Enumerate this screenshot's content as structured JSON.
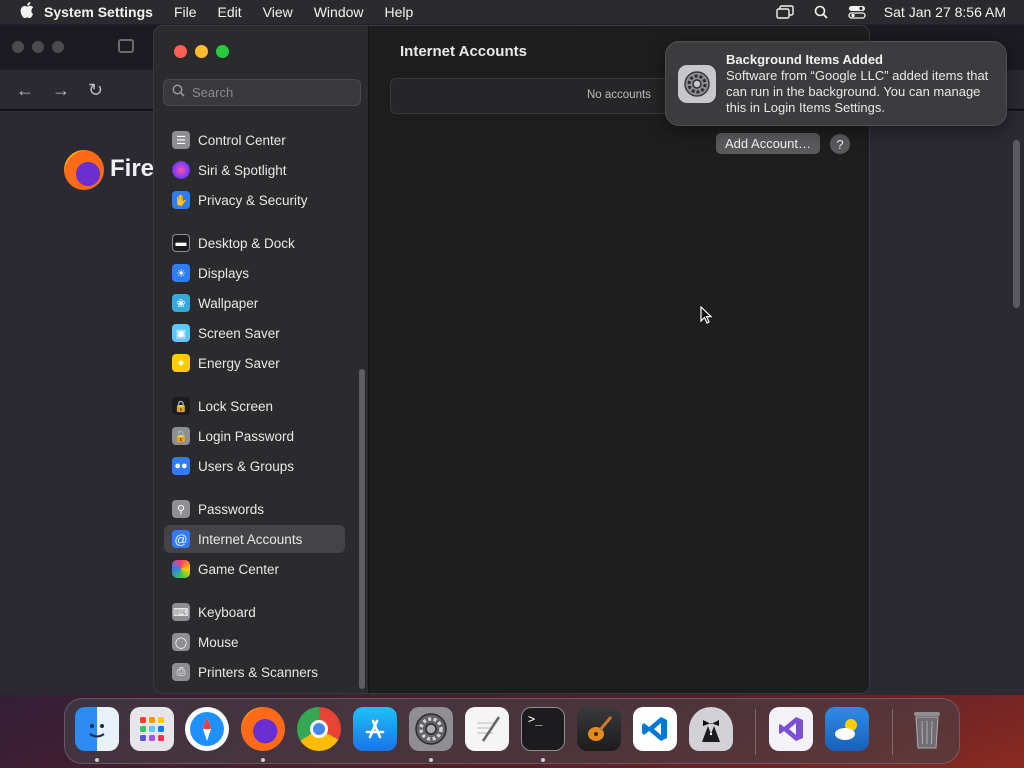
{
  "menubar": {
    "app_name": "System Settings",
    "menus": [
      "File",
      "Edit",
      "View",
      "Window",
      "Help"
    ],
    "clock": "Sat Jan 27  8:56 AM"
  },
  "firefox": {
    "brand_text": "Fire"
  },
  "settings": {
    "search_placeholder": "Search",
    "sidebar_items": [
      {
        "label": "Control Center",
        "icon": "control-center-icon",
        "color": "#8e8e93"
      },
      {
        "label": "Siri & Spotlight",
        "icon": "siri-icon",
        "color": "#b03ad1"
      },
      {
        "label": "Privacy & Security",
        "icon": "hand-icon",
        "color": "#2f7cf6"
      },
      {
        "label": "Desktop & Dock",
        "icon": "dock-icon",
        "color": "#1c1c1e"
      },
      {
        "label": "Displays",
        "icon": "sun-icon",
        "color": "#2f7cf6"
      },
      {
        "label": "Wallpaper",
        "icon": "wallpaper-icon",
        "color": "#34aadc"
      },
      {
        "label": "Screen Saver",
        "icon": "screen-saver-icon",
        "color": "#5ac8fa"
      },
      {
        "label": "Energy Saver",
        "icon": "bulb-icon",
        "color": "#ffcc00"
      },
      {
        "label": "Lock Screen",
        "icon": "lock-icon",
        "color": "#1c1c1e"
      },
      {
        "label": "Login Password",
        "icon": "lock-icon",
        "color": "#8e8e93"
      },
      {
        "label": "Users & Groups",
        "icon": "users-icon",
        "color": "#2f7cf6"
      },
      {
        "label": "Passwords",
        "icon": "key-icon",
        "color": "#8e8e93"
      },
      {
        "label": "Internet Accounts",
        "icon": "at-icon",
        "color": "#2f7cf6"
      },
      {
        "label": "Game Center",
        "icon": "game-center-icon",
        "color": "#ffffff"
      },
      {
        "label": "Keyboard",
        "icon": "keyboard-icon",
        "color": "#8e8e93"
      },
      {
        "label": "Mouse",
        "icon": "mouse-icon",
        "color": "#8e8e93"
      },
      {
        "label": "Printers & Scanners",
        "icon": "printer-icon",
        "color": "#8e8e93"
      }
    ],
    "selected_item": "Internet Accounts",
    "main": {
      "title": "Internet Accounts",
      "empty_text": "No accounts",
      "add_button": "Add Account…",
      "help_label": "?"
    }
  },
  "notification": {
    "title": "Background Items Added",
    "body": "Software from “Google LLC” added items that can run in the background. You can manage this in Login Items Settings."
  },
  "dock": {
    "apps": [
      "Finder",
      "Launchpad",
      "Safari",
      "Firefox",
      "Google Chrome",
      "App Store",
      "System Settings",
      "TextEdit",
      "Terminal",
      "GarageBand",
      "Visual Studio Code",
      "Bartender",
      "Visual Studio",
      "Weather",
      "Trash"
    ]
  }
}
